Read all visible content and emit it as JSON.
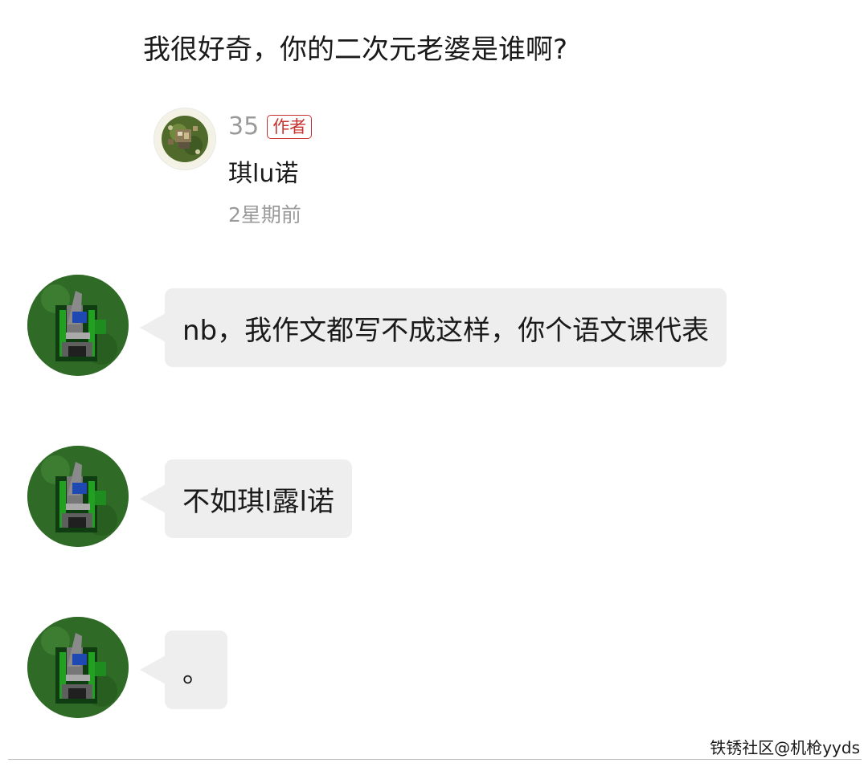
{
  "question": {
    "text": "我很好奇，你的二次元老婆是谁啊?"
  },
  "reply": {
    "avatar_icon": "game-map-avatar-icon",
    "username": "35",
    "badge": "作者",
    "text": "琪lu诺",
    "time": "2星期前"
  },
  "messages": [
    {
      "avatar_icon": "tank-unit-avatar-icon",
      "text": "nb，我作文都写不成这样，你个语文课代表"
    },
    {
      "avatar_icon": "tank-unit-avatar-icon",
      "text": "不如琪l露l诺"
    },
    {
      "avatar_icon": "tank-unit-avatar-icon",
      "text": "。"
    }
  ],
  "footer": {
    "watermark": "铁锈社区@机枪yyds"
  },
  "colors": {
    "badge": "#c8322e",
    "bubble": "#eeeeee",
    "muted_text": "#9a9a9a"
  }
}
